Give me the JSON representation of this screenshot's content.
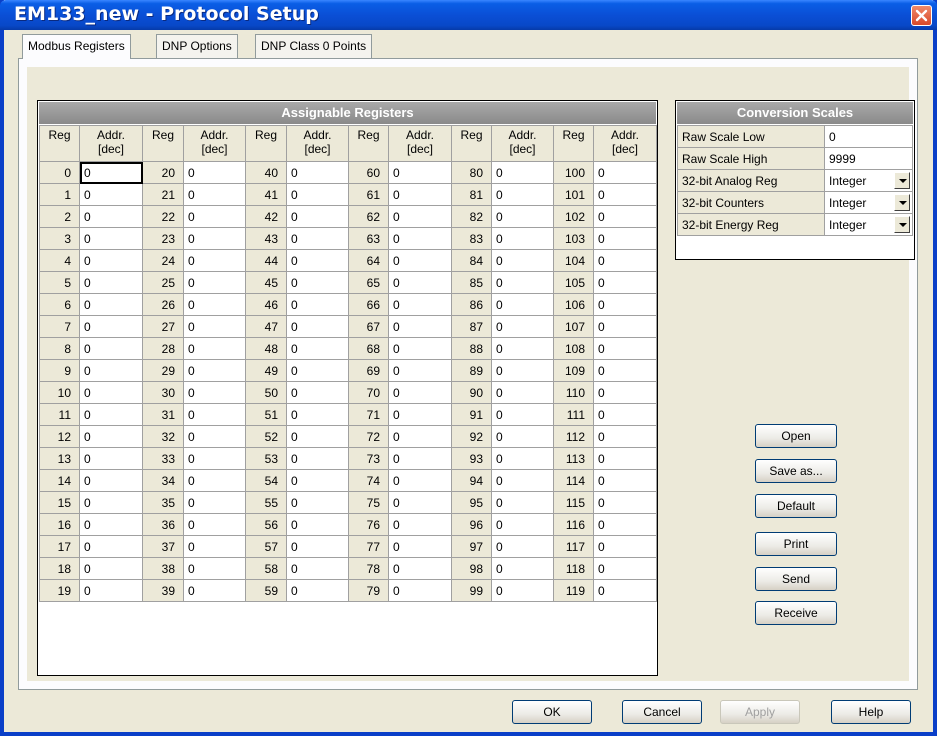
{
  "window": {
    "title": "EM133_new - Protocol Setup"
  },
  "tabs": [
    "Modbus Registers",
    "DNP Options",
    "DNP Class 0 Points"
  ],
  "registers": {
    "title": "Assignable Registers",
    "col_reg": "Reg",
    "col_addr": "Addr.",
    "col_addr_unit": "[dec]",
    "rows": [
      [
        "0",
        "0",
        "20",
        "0",
        "40",
        "0",
        "60",
        "0",
        "80",
        "0",
        "100",
        "0"
      ],
      [
        "1",
        "0",
        "21",
        "0",
        "41",
        "0",
        "61",
        "0",
        "81",
        "0",
        "101",
        "0"
      ],
      [
        "2",
        "0",
        "22",
        "0",
        "42",
        "0",
        "62",
        "0",
        "82",
        "0",
        "102",
        "0"
      ],
      [
        "3",
        "0",
        "23",
        "0",
        "43",
        "0",
        "63",
        "0",
        "83",
        "0",
        "103",
        "0"
      ],
      [
        "4",
        "0",
        "24",
        "0",
        "44",
        "0",
        "64",
        "0",
        "84",
        "0",
        "104",
        "0"
      ],
      [
        "5",
        "0",
        "25",
        "0",
        "45",
        "0",
        "65",
        "0",
        "85",
        "0",
        "105",
        "0"
      ],
      [
        "6",
        "0",
        "26",
        "0",
        "46",
        "0",
        "66",
        "0",
        "86",
        "0",
        "106",
        "0"
      ],
      [
        "7",
        "0",
        "27",
        "0",
        "47",
        "0",
        "67",
        "0",
        "87",
        "0",
        "107",
        "0"
      ],
      [
        "8",
        "0",
        "28",
        "0",
        "48",
        "0",
        "68",
        "0",
        "88",
        "0",
        "108",
        "0"
      ],
      [
        "9",
        "0",
        "29",
        "0",
        "49",
        "0",
        "69",
        "0",
        "89",
        "0",
        "109",
        "0"
      ],
      [
        "10",
        "0",
        "30",
        "0",
        "50",
        "0",
        "70",
        "0",
        "90",
        "0",
        "110",
        "0"
      ],
      [
        "11",
        "0",
        "31",
        "0",
        "51",
        "0",
        "71",
        "0",
        "91",
        "0",
        "111",
        "0"
      ],
      [
        "12",
        "0",
        "32",
        "0",
        "52",
        "0",
        "72",
        "0",
        "92",
        "0",
        "112",
        "0"
      ],
      [
        "13",
        "0",
        "33",
        "0",
        "53",
        "0",
        "73",
        "0",
        "93",
        "0",
        "113",
        "0"
      ],
      [
        "14",
        "0",
        "34",
        "0",
        "54",
        "0",
        "74",
        "0",
        "94",
        "0",
        "114",
        "0"
      ],
      [
        "15",
        "0",
        "35",
        "0",
        "55",
        "0",
        "75",
        "0",
        "95",
        "0",
        "115",
        "0"
      ],
      [
        "16",
        "0",
        "36",
        "0",
        "56",
        "0",
        "76",
        "0",
        "96",
        "0",
        "116",
        "0"
      ],
      [
        "17",
        "0",
        "37",
        "0",
        "57",
        "0",
        "77",
        "0",
        "97",
        "0",
        "117",
        "0"
      ],
      [
        "18",
        "0",
        "38",
        "0",
        "58",
        "0",
        "78",
        "0",
        "98",
        "0",
        "118",
        "0"
      ],
      [
        "19",
        "0",
        "39",
        "0",
        "59",
        "0",
        "79",
        "0",
        "99",
        "0",
        "119",
        "0"
      ]
    ]
  },
  "conversion": {
    "title": "Conversion Scales",
    "rows": [
      {
        "label": "Raw Scale Low",
        "value": "0"
      },
      {
        "label": "Raw Scale High",
        "value": "9999"
      },
      {
        "label": "32-bit Analog Reg",
        "value": "Integer"
      },
      {
        "label": "32-bit Counters",
        "value": "Integer"
      },
      {
        "label": "32-bit Energy Reg",
        "value": "Integer"
      }
    ]
  },
  "side_buttons": [
    "Open",
    "Save as...",
    "Default",
    "Print",
    "Send",
    "Receive"
  ],
  "bottom_buttons": {
    "ok": "OK",
    "cancel": "Cancel",
    "apply": "Apply",
    "help": "Help"
  }
}
